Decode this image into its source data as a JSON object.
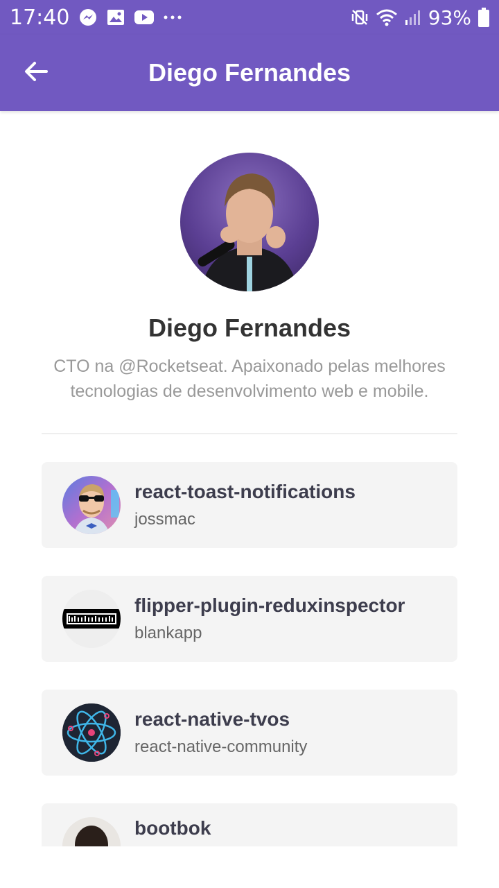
{
  "status_bar": {
    "time": "17:40",
    "notification_icons": [
      "messenger-icon",
      "image-icon",
      "youtube-icon",
      "more-icon"
    ],
    "battery_percent": "93%"
  },
  "app_bar": {
    "title": "Diego Fernandes",
    "color": "#7159c1"
  },
  "profile": {
    "name": "Diego Fernandes",
    "bio": "CTO na @Rocketseat. Apaixonado pelas melhores tecnologias de desenvolvimento web e mobile."
  },
  "repositories": [
    {
      "name": "react-toast-notifications",
      "owner": "jossmac"
    },
    {
      "name": "flipper-plugin-reduxinspector",
      "owner": "blankapp"
    },
    {
      "name": "react-native-tvos",
      "owner": "react-native-community"
    },
    {
      "name": "bootbok",
      "owner": ""
    }
  ]
}
